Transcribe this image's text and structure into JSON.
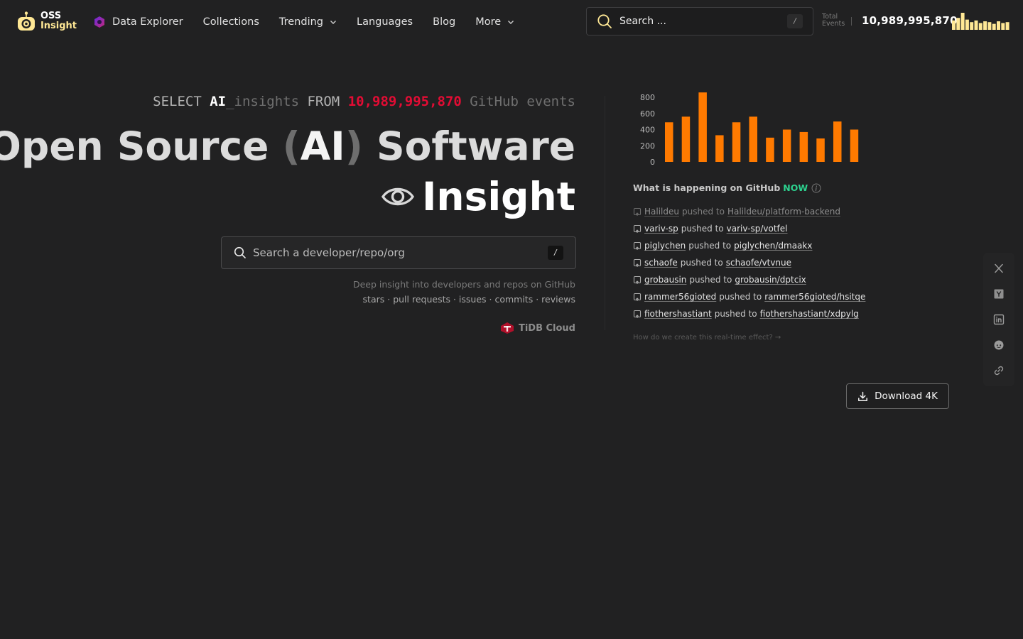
{
  "brand": {
    "line1": "OSS",
    "line2": "Insight"
  },
  "nav": {
    "items": [
      {
        "label": "Data Explorer",
        "icon": "data-explorer-icon"
      },
      {
        "label": "Collections"
      },
      {
        "label": "Trending",
        "dropdown": true
      },
      {
        "label": "Languages"
      },
      {
        "label": "Blog"
      },
      {
        "label": "More",
        "dropdown": true
      }
    ]
  },
  "top_search": {
    "placeholder": "Search ...",
    "shortcut": "/"
  },
  "total_events": {
    "label_line1": "Total",
    "label_line2": "Events",
    "value": "10,989,995,870"
  },
  "hero": {
    "sql": {
      "select": "SELECT ",
      "ai": "AI",
      "insights": "_insights",
      "from": " FROM ",
      "count": "10,989,995,870",
      "tail": " GitHub events"
    },
    "title_line1_a": "Open Source ",
    "paren_open": "(",
    "ai": "AI",
    "paren_close": ")",
    "title_line1_b": " Software",
    "title_line2": "Insight",
    "search": {
      "placeholder": "Search a developer/repo/org",
      "shortcut": "/"
    },
    "subtitle": "Deep insight into developers and repos on GitHub",
    "tags": "stars · pull requests · issues · commits · reviews",
    "powered_by": "TiDB Cloud"
  },
  "activity": {
    "title": "What is happening on GitHub",
    "now": "NOW",
    "events": [
      {
        "actor": "Halildeu",
        "verb": "pushed to",
        "repo": "Halildeu/platform-backend",
        "faded": true
      },
      {
        "actor": "variv-sp",
        "verb": "pushed to",
        "repo": "variv-sp/votfel"
      },
      {
        "actor": "piglychen",
        "verb": "pushed to",
        "repo": "piglychen/dmaakx"
      },
      {
        "actor": "schaofe",
        "verb": "pushed to",
        "repo": "schaofe/vtvnue"
      },
      {
        "actor": "grobausin",
        "verb": "pushed to",
        "repo": "grobausin/dptcix"
      },
      {
        "actor": "rammer56gioted",
        "verb": "pushed to",
        "repo": "rammer56gioted/hsitqe"
      },
      {
        "actor": "fiothershastiant",
        "verb": "pushed to",
        "repo": "fiothershastiant/xdpylg"
      }
    ],
    "how_link": "How do we create this real-time effect? →"
  },
  "download": {
    "label": "Download 4K"
  },
  "share": [
    "x-icon",
    "hackernews-icon",
    "linkedin-icon",
    "reddit-icon",
    "link-icon"
  ],
  "colors": {
    "bar": "#ff7a00",
    "mini_bar": "#ffe895",
    "accent_red": "#e30c34",
    "now_green": "#2cd28f",
    "background": "#212122"
  },
  "chart_data": {
    "type": "bar",
    "yticks": [
      "0",
      "200",
      "400",
      "600",
      "800"
    ],
    "ylim": [
      0,
      800
    ],
    "values": [
      490,
      560,
      860,
      330,
      490,
      560,
      300,
      400,
      370,
      290,
      500,
      400
    ],
    "grid": false
  },
  "mini_chart_data": {
    "type": "bar",
    "values": [
      0.55,
      0.7,
      1.0,
      0.6,
      0.45,
      0.55,
      0.4,
      0.5,
      0.45,
      0.35,
      0.5,
      0.4,
      0.45
    ]
  }
}
